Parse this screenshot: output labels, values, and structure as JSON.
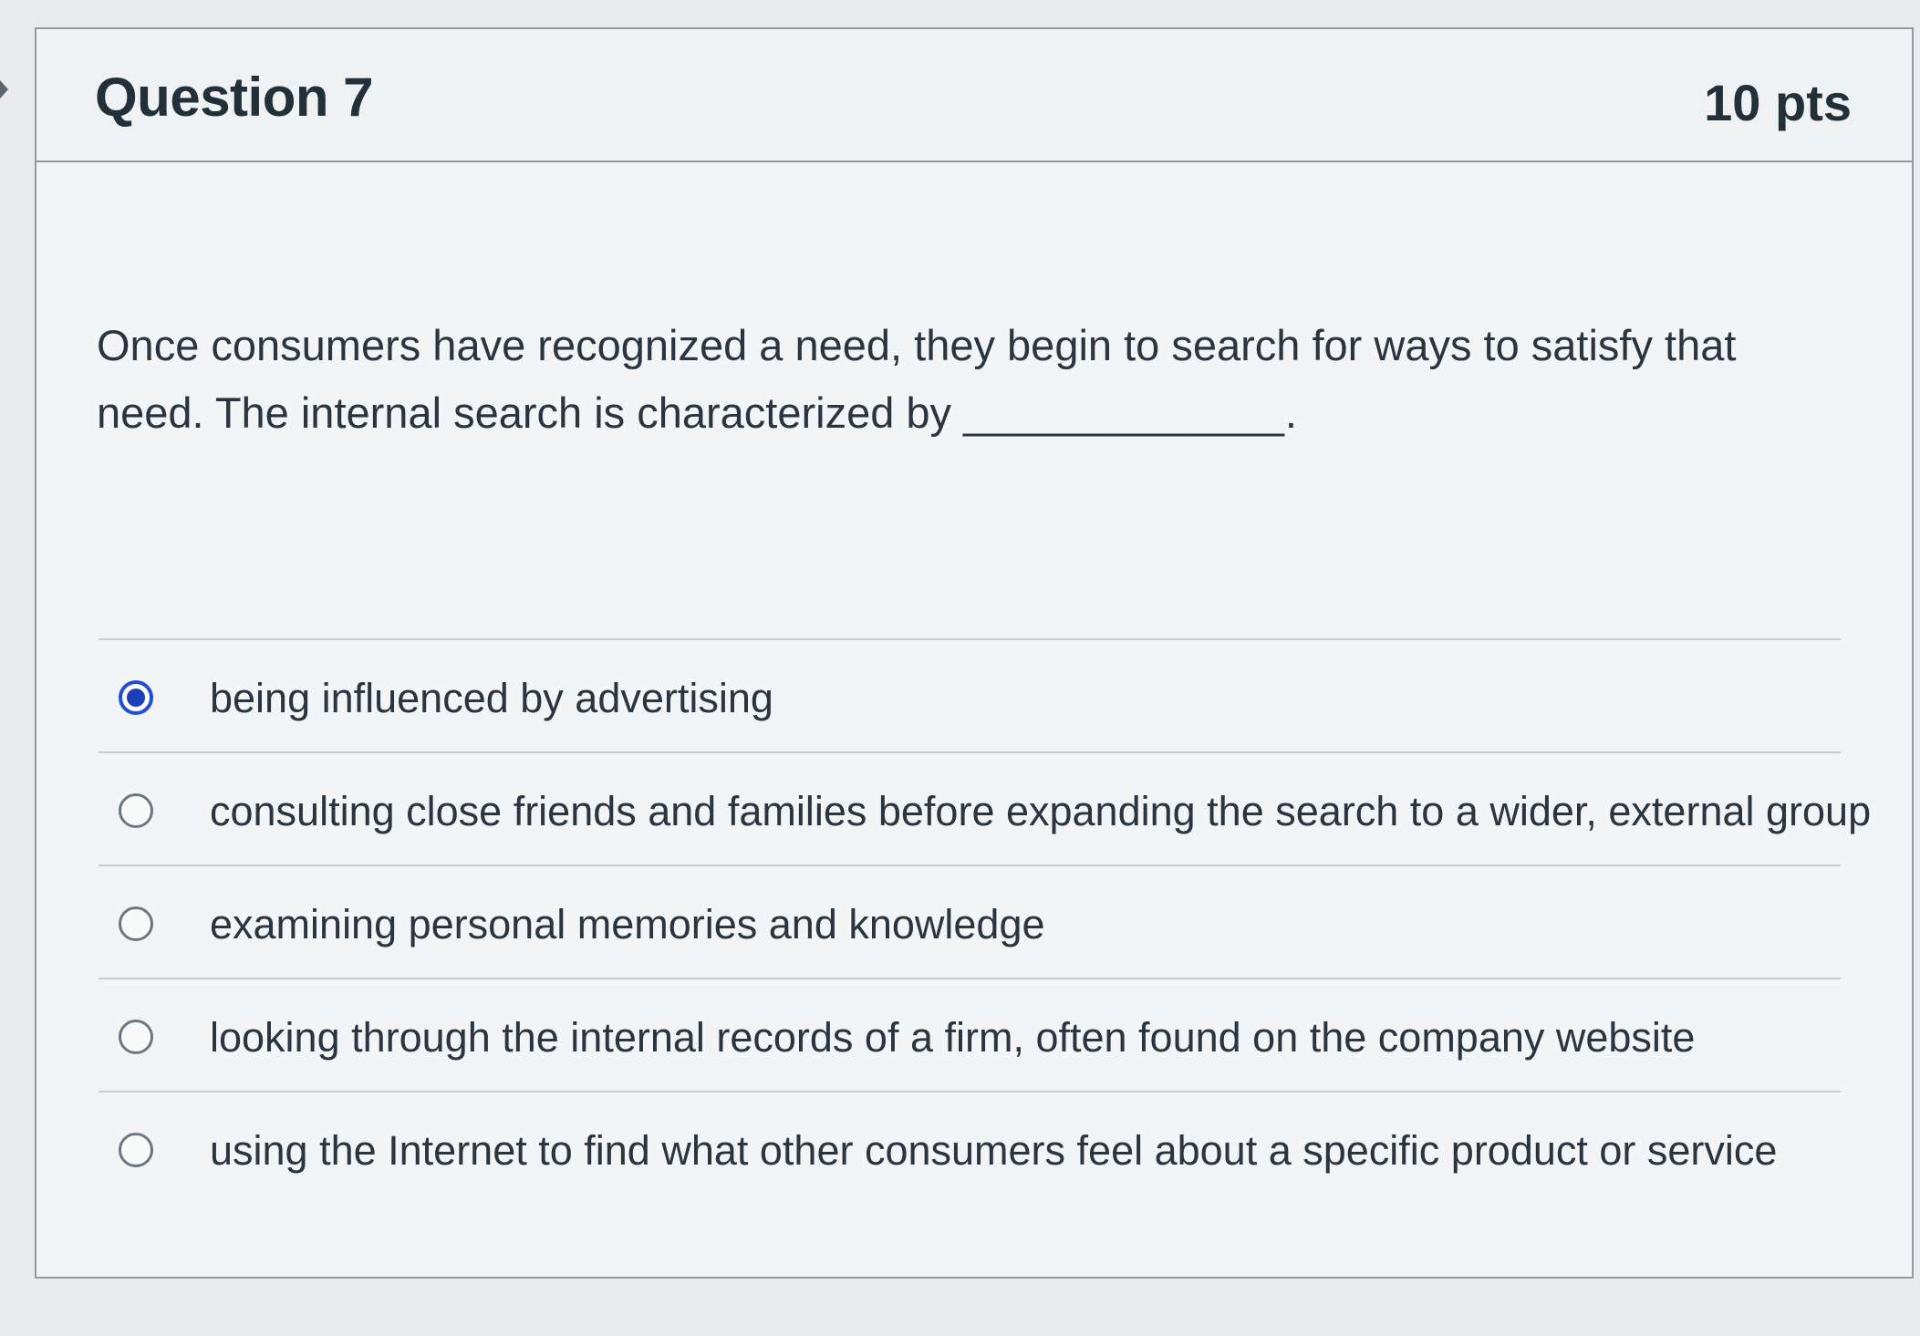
{
  "question": {
    "title": "Question 7",
    "points": "10 pts",
    "text": "Once consumers have recognized a need, they begin to search for ways to satisfy that need. The internal search is characterized by",
    "blank": "_____________."
  },
  "answers": [
    {
      "label": "being influenced by advertising",
      "selected": true
    },
    {
      "label": "consulting close friends and families before expanding the search to a wider, external group",
      "selected": false
    },
    {
      "label": "examining personal memories and knowledge",
      "selected": false
    },
    {
      "label": "looking through the internal records of a firm, often found on the company website",
      "selected": false
    },
    {
      "label": "using the Internet to find what other consumers feel about a specific product or service",
      "selected": false
    }
  ],
  "colors": {
    "selected_radio": "#1f4fd6",
    "text": "#2a3540",
    "border": "#8f9aa2"
  }
}
